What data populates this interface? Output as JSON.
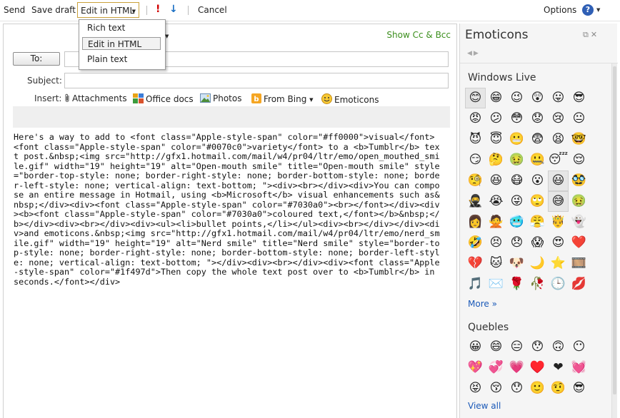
{
  "toolbar": {
    "send": "Send",
    "save_draft": "Save draft",
    "edit_mode": "Edit in HTML",
    "importance_high": "!",
    "importance_low": "↓",
    "cancel": "Cancel",
    "options": "Options",
    "help": "?"
  },
  "format_menu": {
    "items": [
      "Rich text",
      "Edit in HTML",
      "Plain text"
    ],
    "selected": "Edit in HTML"
  },
  "compose": {
    "show_cc_bcc": "Show Cc & Bcc",
    "to_label": "To:",
    "to_value": "",
    "subject_label": "Subject:",
    "subject_value": "",
    "insert_label": "Insert:",
    "insert_items": {
      "attachments": "Attachments",
      "office_docs": "Office docs",
      "photos": "Photos",
      "from_bing": "From Bing",
      "emoticons": "Emoticons"
    },
    "body": "Here's a way to add to <font class=\"Apple-style-span\" color=\"#ff0000\">visual</font> <font class=\"Apple-style-span\" color=\"#0070c0\">variety</font> to a <b>Tumblr</b> text post.&nbsp;<img src=\"http://gfx1.hotmail.com/mail/w4/pr04/ltr/emo/open_mouthed_smile.gif\" width=\"19\" height=\"19\" alt=\"Open-mouth smile\" title=\"Open-mouth smile\" style=\"border-top-style: none; border-right-style: none; border-bottom-style: none; border-left-style: none; vertical-align: text-bottom; \"><div><br></div><div>You can compose an entire message in Hotmail, using <b>Microsoft</b> visual enhancements such as&nbsp;</div><div><font class=\"Apple-style-span\" color=\"#7030a0\"><br></font></div><div><b><font class=\"Apple-style-span\" color=\"#7030a0\">coloured text,</font></b>&nbsp;</b></div><div><br></div><div><ul><li>bullet points,</li></ul><div><br></div></div><div>and emoticons.&nbsp;<img src=\"http://gfx1.hotmail.com/mail/w4/pr04/ltr/emo/nerd_smile.gif\" width=\"19\" height=\"19\" alt=\"Nerd smile\" title=\"Nerd smile\" style=\"border-top-style: none; border-right-style: none; border-bottom-style: none; border-left-style: none; vertical-align: text-bottom; \"></div><div><br></div><div><font class=\"Apple-style-span\" color=\"#1f497d\">Then copy the whole text post over to <b>Tumblr</b> in seconds.</font></div>"
  },
  "panel": {
    "title": "Emoticons",
    "windows_live": {
      "title": "Windows Live",
      "emoticons": [
        "😊",
        "😁",
        "😉",
        "😲",
        "😛",
        "😎",
        "😡",
        "😕",
        "😳",
        "😟",
        "😢",
        "😐",
        "😈",
        "😇",
        "😬",
        "😨",
        "😫",
        "🤓",
        "😏",
        "🤔",
        "🤢",
        "🤐",
        "😴",
        "😌",
        "🧐",
        "😆",
        "😷",
        "😮",
        "😃",
        "🥸",
        "🥷",
        "😭",
        "😜",
        "🙄",
        "😅",
        "🤢",
        "👩",
        "🙅",
        "🥶",
        "😤",
        "🤴",
        "👻",
        "🤣",
        "😣",
        "😞",
        "😱",
        "😍",
        "❤️",
        "💔",
        "🐱",
        "🐶",
        "🌙",
        "⭐",
        "🎞️",
        "🎵",
        "✉️",
        "🌹",
        "🥀",
        "🕒",
        "💋"
      ],
      "more": "More »"
    },
    "quebles": {
      "title": "Quebles",
      "emoticons": [
        "😀",
        "😄",
        "😑",
        "😯",
        "🙃",
        "😶",
        "💖",
        "💞",
        "💗",
        "♥️",
        "❤",
        "💓",
        "😝",
        "😚",
        "😯",
        "🙂",
        "🤨",
        "😎"
      ],
      "view_all": "View all"
    }
  },
  "colors": {
    "accent_green": "#3c8f1d",
    "link_blue": "#1a59b8",
    "dropdown_border": "#c9a13a",
    "panel_bg": "#f5f5f5"
  }
}
